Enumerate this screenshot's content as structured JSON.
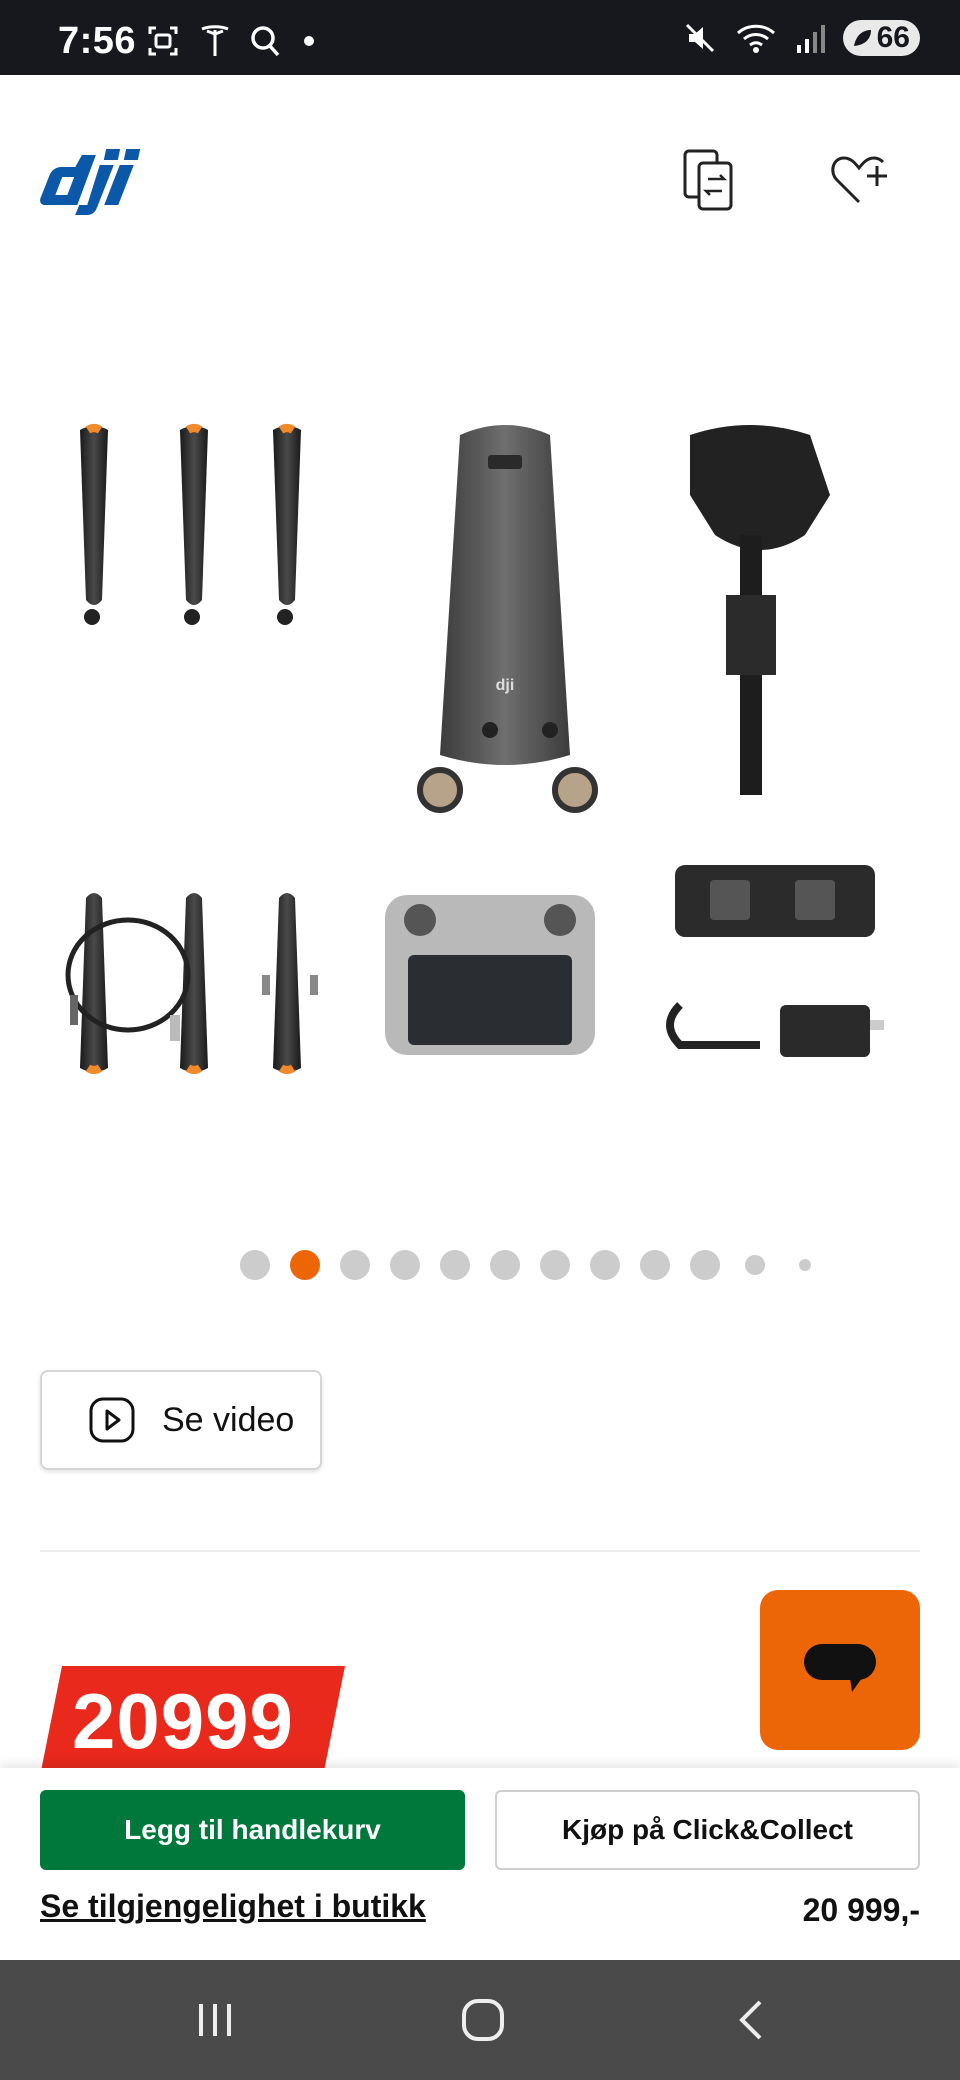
{
  "status_bar": {
    "time": "7:56",
    "battery": "66",
    "icons": [
      "screenshot-icon",
      "tesla-icon",
      "search-icon",
      "dot-icon",
      "mute-icon",
      "wifi-icon",
      "signal-icon",
      "battery-icon"
    ]
  },
  "header": {
    "logo_alt": "dji",
    "compare_icon": "compare-icon",
    "wishlist_icon": "heart-plus-icon"
  },
  "gallery": {
    "total_dots": 12,
    "active_index": 1,
    "accent_color": "#ec6608"
  },
  "video_button": {
    "label": "Se video"
  },
  "price": {
    "badge": "20999",
    "formatted": "20 999,-"
  },
  "actions": {
    "add_to_cart": "Legg til handlekurv",
    "click_collect": "Kjøp på Click&Collect",
    "availability_link": "Se tilgjengelighet i butikk"
  },
  "colors": {
    "brand_blue": "#0b58a8",
    "price_red": "#e8291c",
    "cart_green": "#00783c",
    "chat_orange": "#ec6608"
  }
}
